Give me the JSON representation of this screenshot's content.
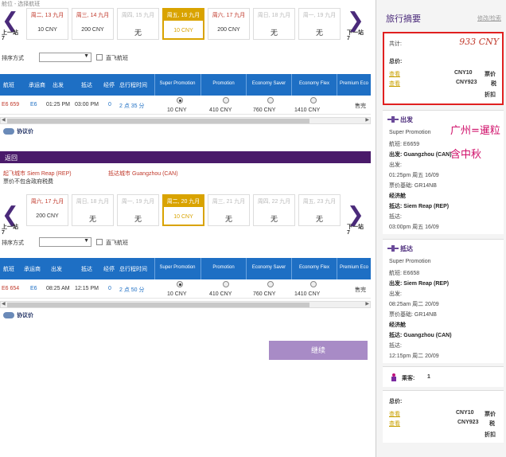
{
  "top_crumb": "舱位 - 选择航班",
  "nav": {
    "prev": "上一站",
    "next": "下一站",
    "prev_suffix": "7",
    "next_suffix": "7"
  },
  "outbound": {
    "dates": [
      {
        "date": "周二, 13 九月",
        "price": "10  CNY",
        "state": "normal"
      },
      {
        "date": "周三, 14 九月",
        "price": "200  CNY",
        "state": "normal"
      },
      {
        "date": "周四, 15 九月",
        "price": "无",
        "state": "na"
      },
      {
        "date": "周五, 16 九月",
        "price": "10  CNY",
        "state": "sel"
      },
      {
        "date": "周六, 17 九月",
        "price": "200  CNY",
        "state": "normal"
      },
      {
        "date": "周日, 18 九月",
        "price": "无",
        "state": "na"
      },
      {
        "date": "周一, 19 九月",
        "price": "无",
        "state": "na"
      }
    ],
    "sort_label": "排序方式",
    "direct_label": "直飞航班",
    "flight": {
      "no": "E6 659",
      "carrier": "E6",
      "depart": "01:25 PM",
      "arrive": "03:00 PM",
      "stops": "0",
      "duration": "2 点 35 分",
      "prices": [
        "10  CNY",
        "410  CNY",
        "760  CNY",
        "1410  CNY"
      ],
      "premium": "售完"
    },
    "agreement": "协议价"
  },
  "headers": [
    "航班",
    "承运商",
    "出发",
    "抵达",
    "经停",
    "总行程时间"
  ],
  "fare_cols": [
    "Super Promotion",
    "Promotion",
    "Economy Saver",
    "Economy Flex",
    "Premium Eco"
  ],
  "return": {
    "bar": "返回",
    "origin": "起飞城市 Siem Reap (REP)",
    "dest": "抵达城市 Guangzhou (CAN)",
    "taxnote": "票价不包含政府税费",
    "dates": [
      {
        "date": "周六, 17 九月",
        "price": "200  CNY",
        "state": "normal"
      },
      {
        "date": "周日, 18 九月",
        "price": "无",
        "state": "na"
      },
      {
        "date": "周一, 19 九月",
        "price": "无",
        "state": "na"
      },
      {
        "date": "周二, 20 九月",
        "price": "10  CNY",
        "state": "sel"
      },
      {
        "date": "周三, 21 九月",
        "price": "无",
        "state": "na"
      },
      {
        "date": "周四, 22 九月",
        "price": "无",
        "state": "na"
      },
      {
        "date": "周五, 23 九月",
        "price": "无",
        "state": "na"
      }
    ],
    "sort_label": "排序方式",
    "direct_label": "直飞航班",
    "flight": {
      "no": "E6 654",
      "carrier": "E6",
      "depart": "08:25 AM",
      "arrive": "12:15 PM",
      "stops": "0",
      "duration": "2 点 50 分",
      "prices": [
        "10  CNY",
        "410  CNY",
        "760  CNY",
        "1410  CNY"
      ],
      "premium": "售完"
    },
    "agreement": "协议价"
  },
  "continue": "继续",
  "summary": {
    "title": "旅行摘要",
    "edit": "修改/检索",
    "total_label": "共计:",
    "total_value": "933  CNY",
    "price_head": "总价:",
    "view": "查看",
    "amt1": "CNY10",
    "amt1_lbl": "票价",
    "amt2": "CNY923",
    "amt2_lbl": "税",
    "discount": "折扣",
    "out_head": "出发",
    "out_lines": [
      "Super Promotion",
      "航班:  E6659",
      "出发:  Guangzhou (CAN)",
      "出发:",
      "01:25pm  周五  16/09",
      "票价基础:  GR14NB",
      "经济舱",
      "抵达:  Siem Reap (REP)",
      "抵达:",
      "03:00pm  周五  16/09"
    ],
    "ret_head": "抵达",
    "ret_lines": [
      "Super Promotion",
      "航班:  E6658",
      "出发:  Siem Reap (REP)",
      "出发:",
      "08:25am  周二  20/09",
      "票价基础:  GR14NB",
      "经济舱",
      "抵达:  Guangzhou (CAN)",
      "抵达:",
      "12:15pm  周二  20/09"
    ],
    "annot1": "广州=暹粒",
    "annot2": "含中秋",
    "pax_label": "乘客:",
    "pax_count": "1",
    "price_head2": "总价:",
    "amt3": "CNY10",
    "amt3_lbl": "票价",
    "amt4": "CNY923",
    "amt4_lbl": "税",
    "discount2": "折扣"
  }
}
